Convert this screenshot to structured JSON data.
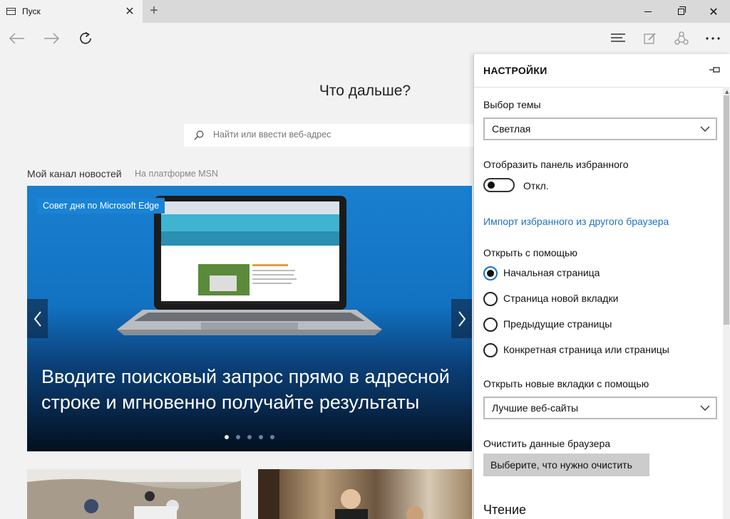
{
  "tab": {
    "title": "Пуск"
  },
  "page": {
    "headline": "Что дальше?",
    "search_placeholder": "Найти или ввести веб-адрес",
    "news_heading": "Мой канал новостей",
    "news_source": "На платформе MSN",
    "hero": {
      "tag": "Совет дня по Microsoft Edge",
      "title": "Вводите поисковый запрос прямо в адресной строке и мгновенно получайте результаты",
      "slides_total": 5,
      "slide_active": 1
    }
  },
  "settings": {
    "title": "НАСТРОЙКИ",
    "theme_label": "Выбор темы",
    "theme_value": "Светлая",
    "favorites_bar_label": "Отобразить панель избранного",
    "favorites_bar_state": "Откл.",
    "import_link": "Импорт избранного из другого браузера",
    "open_with_label": "Открыть с помощью",
    "open_with_options": [
      "Начальная страница",
      "Страница новой вкладки",
      "Предыдущие страницы",
      "Конкретная страница или страницы"
    ],
    "open_with_selected": 0,
    "new_tabs_label": "Открыть новые вкладки с помощью",
    "new_tabs_value": "Лучшие веб-сайты",
    "clear_data_label": "Очистить данные браузера",
    "clear_button": "Выберите, что нужно очистить",
    "reading_heading": "Чтение"
  },
  "colors": {
    "accent": "#1d73c2",
    "panel_bg": "#ffffff",
    "page_bg": "#f2f2f2"
  }
}
